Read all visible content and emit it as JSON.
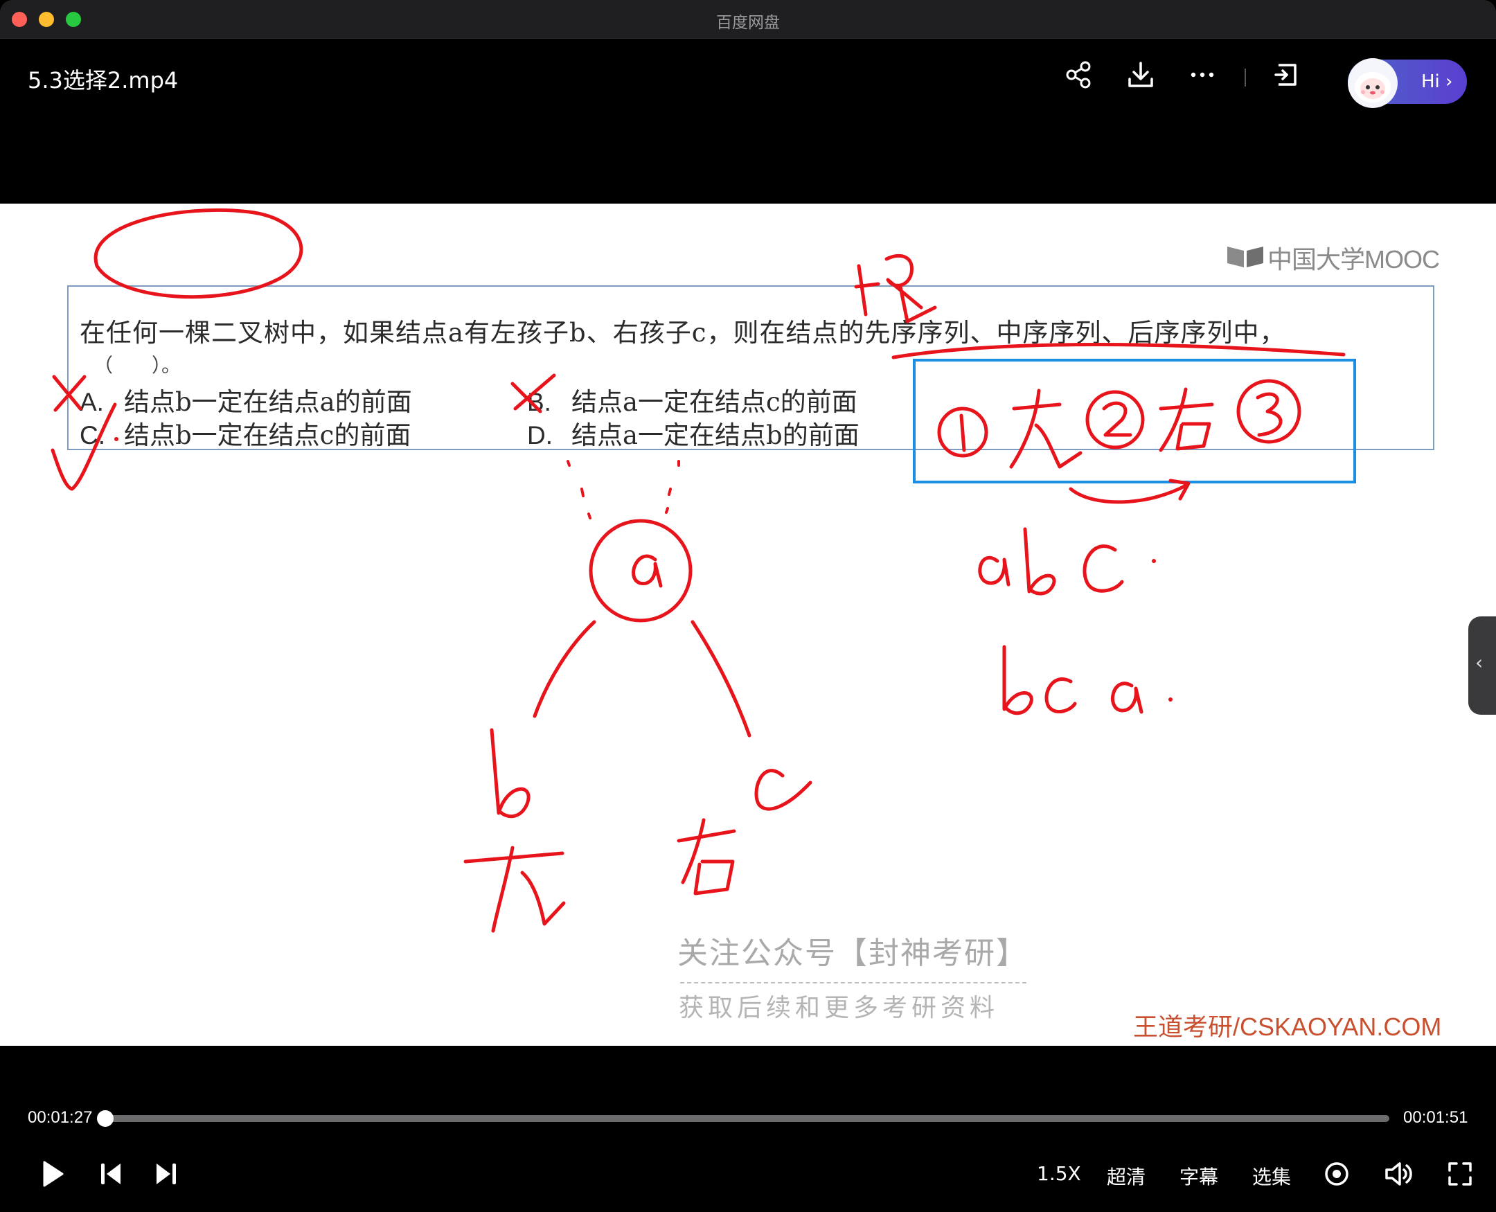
{
  "window": {
    "app_title": "百度网盘"
  },
  "topbar": {
    "file_title": "5.3选择2.mp4",
    "icons": [
      "share-icon",
      "download-icon",
      "more-icon",
      "pip-icon"
    ],
    "hi_label": "Hi",
    "hi_chevron": "›"
  },
  "slide": {
    "logo_text": "中国大学MOOC",
    "question": "在任何一棵二叉树中，如果结点a有左孩子b、右孩子c，则在结点的先序序列、中序序列、后序序列中，",
    "blank": "（　　）。",
    "options": [
      {
        "letter": "A.",
        "text": "结点b一定在结点a的前面"
      },
      {
        "letter": "B.",
        "text": "结点a一定在结点c的前面"
      },
      {
        "letter": "C.",
        "text": "结点b一定在结点c的前面"
      },
      {
        "letter": "D.",
        "text": "结点a一定在结点b的前面"
      }
    ],
    "watermark_line1": "关注公众号【封神考研】",
    "watermark_line2": "获取后续和更多考研资料",
    "watermark_site": "王道考研/CSKAOYAN.COM",
    "annotation_color": "#e8141b"
  },
  "player": {
    "current_time": "00:01:27",
    "total_time": "00:01:51",
    "progress": 0.0,
    "speed": "1.5X",
    "quality": "超清",
    "subtitle": "字幕",
    "episodes": "选集"
  }
}
